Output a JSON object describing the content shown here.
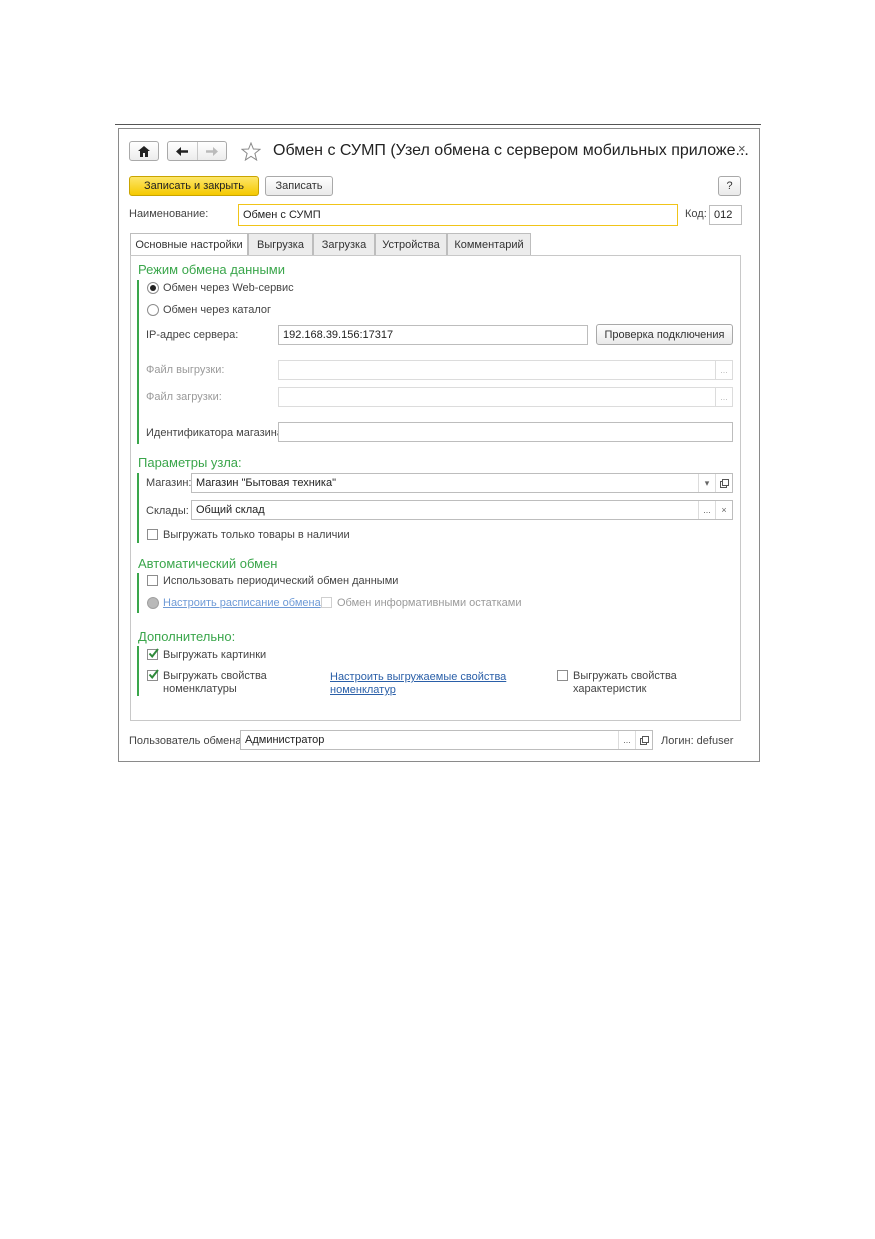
{
  "window": {
    "title": "Обмен с СУМП (Узел обмена с сервером мобильных приложе...",
    "close_glyph": "×"
  },
  "toolbar": {
    "save_close_label": "Записать и закрыть",
    "save_label": "Записать",
    "help_label": "?"
  },
  "header": {
    "name_label": "Наименование:",
    "name_value": "Обмен с СУМП",
    "code_label": "Код:",
    "code_value": "012"
  },
  "tabs": [
    {
      "label": "Основные настройки"
    },
    {
      "label": "Выгрузка"
    },
    {
      "label": "Загрузка"
    },
    {
      "label": "Устройства"
    },
    {
      "label": "Комментарий"
    }
  ],
  "exchange_mode": {
    "section_title": "Режим обмена данными",
    "option_web": "Обмен через Web-сервис",
    "option_catalog": "Обмен через каталог",
    "ip_label": "IP-адрес сервера:",
    "ip_value": "192.168.39.156:17317",
    "check_connection_label": "Проверка подключения",
    "export_file_label": "Файл выгрузки:",
    "import_file_label": "Файл загрузки:",
    "store_id_label": "Идентификатора магазина:",
    "ellipsis": "..."
  },
  "node_params": {
    "section_title": "Параметры узла:",
    "store_label": "Магазин:",
    "store_value": "Магазин \"Бытовая техника\"",
    "warehouses_label": "Склады:",
    "warehouses_value": "Общий склад",
    "only_in_stock_label": "Выгружать только товары в наличии",
    "ellipsis": "...",
    "clear_glyph": "×"
  },
  "auto_exchange": {
    "section_title": "Автоматический обмен",
    "use_periodic_label": "Использовать периодический обмен данными",
    "schedule_link": "Настроить расписание обмена",
    "informative_label": "Обмен информативными остатками"
  },
  "additional": {
    "section_title": "Дополнительно:",
    "export_images_label": "Выгружать картинки",
    "export_props_label_1": "Выгружать свойства",
    "export_props_label_2": "номенклатуры",
    "configure_props_link_1": "Настроить выгружаемые свойства",
    "configure_props_link_2": "номенклатур",
    "export_char_props_label_1": "Выгружать свойства",
    "export_char_props_label_2": "характеристик"
  },
  "footer": {
    "user_label": "Пользователь обмена:",
    "user_value": "Администратор",
    "login_label": "Логин: defuser",
    "ellipsis": "..."
  },
  "colors": {
    "accent_green": "#3aa64b",
    "primary_yellow": "#f5c900",
    "link_blue": "#2a5fa8"
  }
}
